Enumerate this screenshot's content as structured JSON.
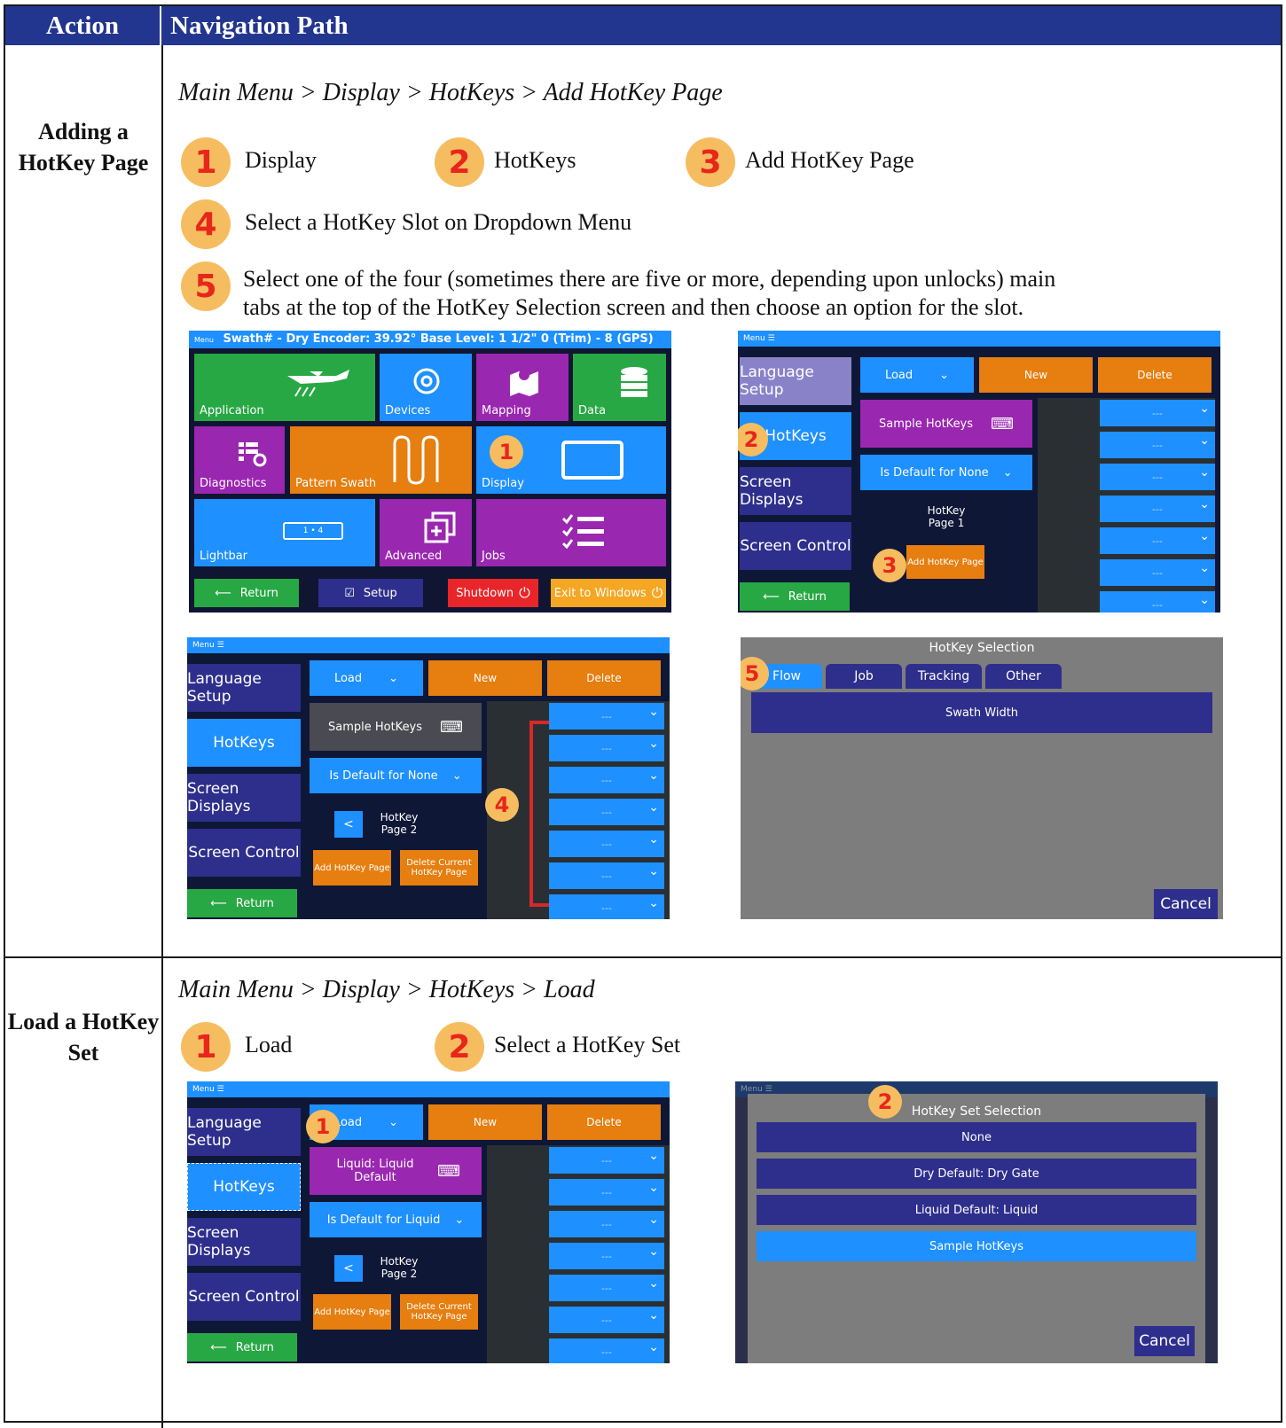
{
  "header": {
    "action": "Action",
    "nav": "Navigation Path"
  },
  "row1": {
    "action": "Adding a HotKey Page",
    "path": "Main Menu > Display > HotKeys > Add HotKey Page",
    "steps": [
      {
        "n": "1",
        "text": "Display"
      },
      {
        "n": "2",
        "text": "HotKeys"
      },
      {
        "n": "3",
        "text": "Add HotKey Page"
      },
      {
        "n": "4",
        "text": "Select a HotKey Slot on Dropdown Menu"
      },
      {
        "n": "5",
        "text": "Select one of the four (sometimes there are five or more, depending upon unlocks) main tabs at the top of the HotKey Selection screen and then choose an option for the slot."
      }
    ]
  },
  "row2": {
    "action": "Load a HotKey Set",
    "path": "Main Menu > Display > HotKeys > Load",
    "steps": [
      {
        "n": "1",
        "text": "Load"
      },
      {
        "n": "2",
        "text": "Select a HotKey Set"
      }
    ]
  },
  "shot1": {
    "menu": "Menu",
    "status": "Swath# -   Dry Encoder: 39.92°   Base Level: 1 1/2\"  0 (Trim) - 8 (GPS)",
    "tiles": [
      "Application",
      "Devices",
      "Mapping",
      "Data",
      "Diagnostics",
      "Pattern Swath",
      "Display",
      "Lightbar",
      "Advanced",
      "Jobs"
    ],
    "lightbar_display": "1  •  4",
    "bottom": [
      "Return",
      "Setup",
      "Shutdown",
      "Exit to Windows"
    ],
    "colors": {
      "green": "#27a844",
      "blue": "#1e90ff",
      "purple": "#9a27b0",
      "orange": "#e67e10",
      "red": "#e8262a",
      "yellow": "#f5a623"
    }
  },
  "hk": {
    "menu": "Menu",
    "side": [
      "Language Setup",
      "HotKeys",
      "Screen Displays",
      "Screen Control",
      "Return"
    ],
    "load": "Load",
    "new": "New",
    "delete": "Delete",
    "sample": "Sample HotKeys",
    "default_none": "Is Default for None",
    "page1": "HotKey Page 1",
    "page2": "HotKey Page 2",
    "add": "Add HotKey Page",
    "delete_page": "Delete Current HotKey Page",
    "slot": "---",
    "back": "<",
    "liquid": "Liquid: Liquid Default",
    "default_liquid": "Is Default for Liquid"
  },
  "sel": {
    "title": "HotKey Selection",
    "tabs": [
      "Flow",
      "Job",
      "Tracking",
      "Other"
    ],
    "option": "Swath Width",
    "cancel": "Cancel"
  },
  "set": {
    "menu": "Menu",
    "title": "HotKey Set Selection",
    "options": [
      "None",
      "Dry Default: Dry Gate",
      "Liquid Default: Liquid",
      "Sample HotKeys"
    ],
    "cancel": "Cancel"
  }
}
